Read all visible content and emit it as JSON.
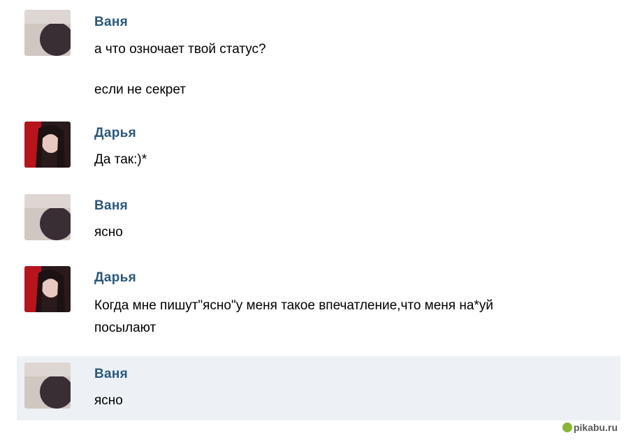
{
  "messages": [
    {
      "author": "Ваня",
      "lines": [
        "а что озночает твой статус?",
        "если не секрет"
      ]
    },
    {
      "author": "Дарья",
      "lines": [
        "Да так:)*"
      ]
    },
    {
      "author": "Ваня",
      "lines": [
        "ясно"
      ]
    },
    {
      "author": "Дарья",
      "lines": [
        "Когда мне пишут\"ясно\"у меня такое впечатление,что меня на*уй",
        "посылают"
      ]
    },
    {
      "author": "Ваня",
      "lines": [
        "ясно"
      ]
    }
  ],
  "watermark": {
    "text": "pikabu.ru"
  },
  "colors": {
    "author": "#2b587a",
    "highlight": "#edf1f5"
  }
}
